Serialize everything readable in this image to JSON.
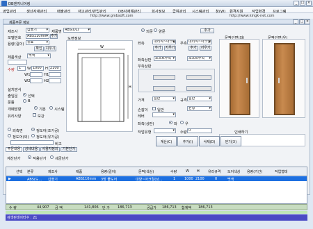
{
  "window": {
    "title": "DB엔지니어링"
  },
  "menu": [
    "영업관리",
    "생산자재관리",
    "매출관리",
    "재고관리/반입관리",
    "DB자재해관리",
    "회사정보",
    "급여관리",
    "시스템관리",
    "창(W)",
    "원격지원",
    "작업환경",
    "프로그램"
  ],
  "url": {
    "left": "http://www.gmbsoft.com",
    "right": "http://www.kingk-net.com"
  },
  "subwindow": {
    "title": "제품주문 정보"
  },
  "form": {
    "client_label": "제조사",
    "client_value": "갑을기",
    "type_label": "제품명",
    "type_value": "ABS(DL)",
    "model_label": "모델번호",
    "model_value": "ABS110mm",
    "model_btn": "추가",
    "unit_label": "용량(길이)",
    "unit_value": "유료",
    "btn_confirm": "확인",
    "btn_clear": "지우기",
    "color_label": "제품색상",
    "color_value": "백색",
    "qty_label": "수량",
    "qty_value": "1",
    "w_label": "W",
    "w_value": "1000",
    "h_label": "H",
    "h_value": "2100",
    "w1_label": "W1",
    "h1_label": "H1",
    "w2_label": "W2",
    "h2_label": "H2",
    "mount_label": "설치방식",
    "lock_label": "출입문",
    "frame_label": "문틀",
    "radio_std": "선택",
    "radio_b": "B",
    "open_label": "개폐방향",
    "open_opt1": "기본",
    "open_opt2": "시스템",
    "glass_label": "유리사양",
    "check_a": "보강",
    "check_b": "없음",
    "inside_label": "외측면",
    "inside_a": "정도어(조가공)",
    "outside_label": "정도어(외)",
    "outside_a": "정도어(유가공)",
    "memo_label": "비고",
    "memo_btn": "800",
    "frame_type_label": "프레임",
    "frame_type_value": "좌",
    "drawing_label": "도면정보"
  },
  "middle": {
    "radio_a": "외문",
    "radio_b": "양문",
    "sel1_label": "좌측",
    "sel1_value": "대리석~아크릴",
    "sel2_label": "우측",
    "sel2_value": "대리석~아크릴",
    "btn_add": "추가",
    "btn_del": "지우기",
    "left_opt_label": "좌측상판",
    "left_opt_value": "소프트부직",
    "right_opt_label": "우측상판",
    "right_opt_value": "소프트부직",
    "price_label": "가격",
    "price_value": "일반",
    "size_label": "규격",
    "size_value": "일반",
    "cut_label": "절단",
    "cut_opt": "일반",
    "lever_label": "손잡이",
    "lever_value": "원형",
    "hinge_label": "레버",
    "guide_label": "좌측(상판)",
    "guide_a": "좌",
    "guide_b": "우",
    "work_label": "작업유형",
    "work_value": "",
    "qty_label": "수량",
    "qty_value": "0"
  },
  "doors": {
    "left_title": "문짝인면(좌)",
    "right_title": "문짝인면(우)",
    "memo": "인쇄하기"
  },
  "actions": [
    {
      "label": "계산(C)"
    },
    {
      "label": "추가(I)"
    },
    {
      "label": "삭제(D)"
    },
    {
      "label": "닫기(X)"
    }
  ],
  "tabs": [
    "주문내용",
    "상세내용",
    "사용자정의",
    "기본단가"
  ],
  "calc": {
    "label": "계산단가",
    "opt1": "적용단가",
    "opt2": "세금단가"
  },
  "table": {
    "headers": [
      "선택",
      "분류",
      "제조사",
      "제품",
      "용량(길이)",
      "문짝(색상)",
      "수량",
      "W",
      "H",
      "유리규격",
      "도어색상",
      "용량(기간)",
      "작업형태"
    ],
    "row": [
      "",
      "ABS(도...",
      "갑을기",
      "ABS110mm",
      "3방 물도어",
      "대양~아크릴(상...",
      "1",
      "1000",
      "2100",
      "0",
      "백색",
      "",
      ""
    ]
  },
  "totals": [
    {
      "label": "수 량",
      "value": "44,907"
    },
    {
      "label": "금 액",
      "value": "141,806"
    },
    {
      "label": "단 가",
      "value": "186,713"
    },
    {
      "label": "공급가",
      "value": "186,713"
    },
    {
      "label": "합계액",
      "value": "186,713"
    }
  ],
  "status": "검색된데이터수 : 21"
}
